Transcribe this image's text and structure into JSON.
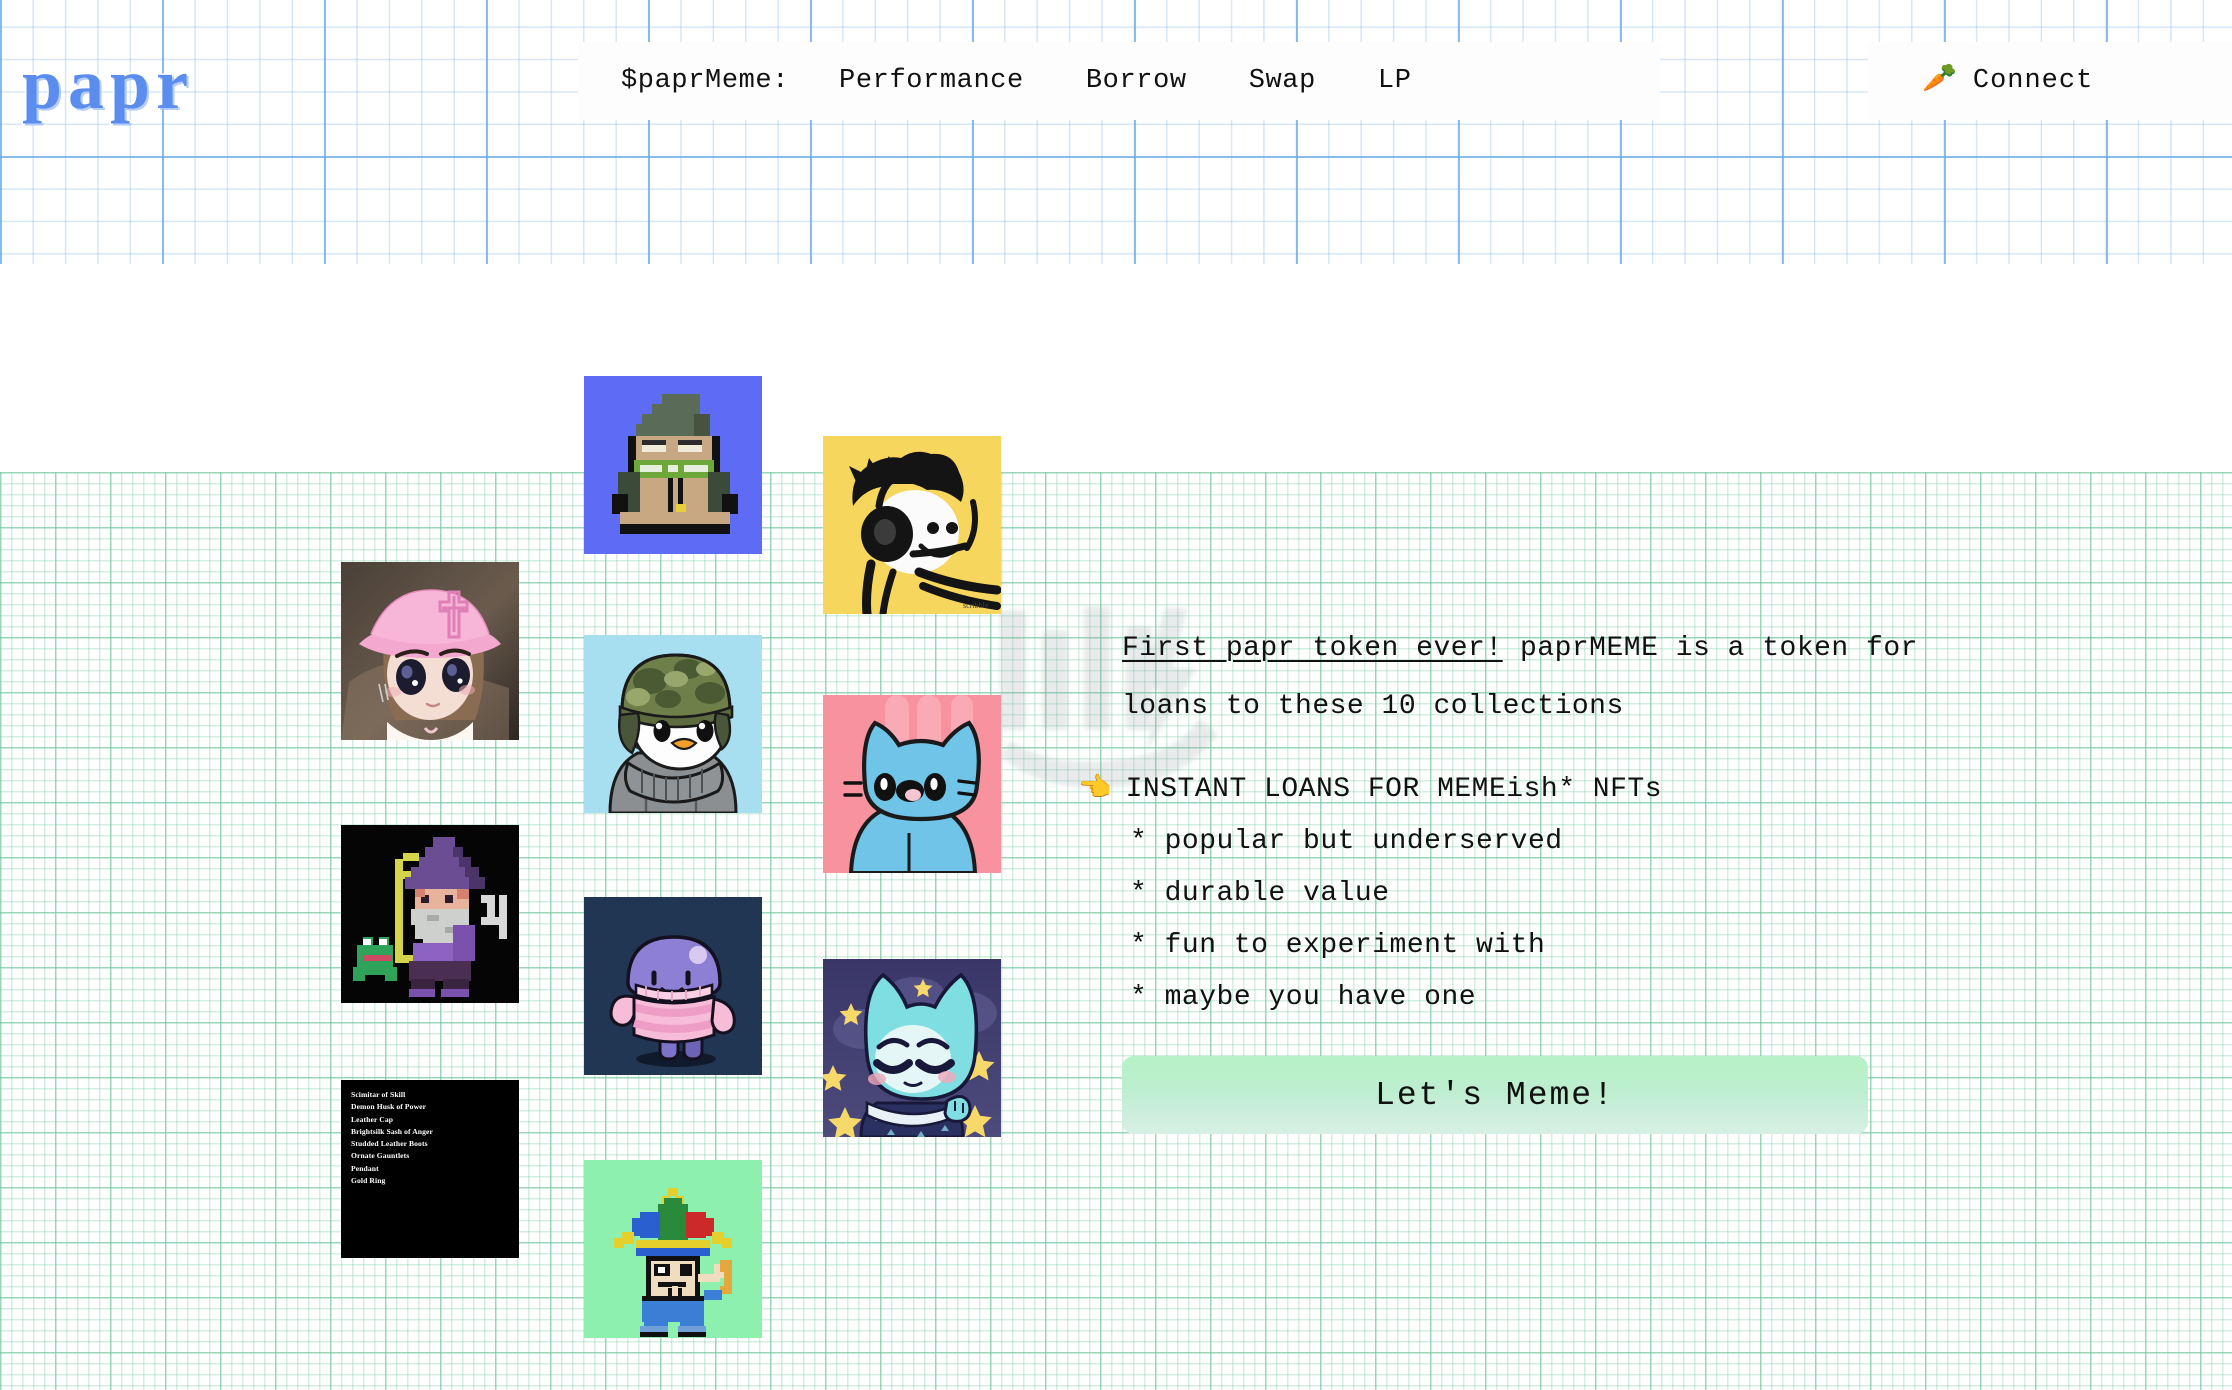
{
  "header": {
    "logo": "papr",
    "nav": [
      {
        "label": "$paprMeme:",
        "name": "nav-paprmeme"
      },
      {
        "label": "Performance",
        "name": "nav-performance"
      },
      {
        "label": "Borrow",
        "name": "nav-borrow"
      },
      {
        "label": "Swap",
        "name": "nav-swap"
      },
      {
        "label": "LP",
        "name": "nav-lp"
      }
    ],
    "connect": {
      "label": "Connect",
      "icon": "carrot-icon",
      "glyph": "🥕"
    }
  },
  "hero": {
    "lede_link": "First papr token ever!",
    "lede_rest": " paprMEME is a token for loans to these 10 collections",
    "point_emoji": "👈",
    "point_headline": "INSTANT LOANS FOR MEMEish* NFTs",
    "points": [
      "* popular but underserved",
      "* durable value",
      "* fun to experiment with",
      "* maybe you have one"
    ],
    "cta_label": "Let's Meme!"
  },
  "gallery": {
    "items": [
      {
        "name": "nft-milady-pink-cap",
        "alt": "anime girl with pink cross cap"
      },
      {
        "name": "nft-pixel-wizard",
        "alt": "pixel wizard with frog and staff"
      },
      {
        "name": "nft-loot-bag",
        "alt": "loot bag item list"
      },
      {
        "name": "nft-pixel-frog",
        "alt": "pixel frog on blue"
      },
      {
        "name": "nft-pudgy-penguin",
        "alt": "penguin with camo helmet"
      },
      {
        "name": "nft-purple-blob",
        "alt": "purple blob in pink striped sweater"
      },
      {
        "name": "nft-pixel-jester",
        "alt": "pixel jester on green"
      },
      {
        "name": "nft-doodle-headphones",
        "alt": "doodle face with headphones on yellow"
      },
      {
        "name": "nft-blue-cat",
        "alt": "blue cat on pink"
      },
      {
        "name": "nft-sleepy-cat",
        "alt": "sleepy blue cat with stars"
      }
    ],
    "loot_items": [
      "Scimitar of Skill",
      "Demon Husk of Power",
      "Leather Cap",
      "Brightsilk Sash of Anger",
      "Studded Leather Boots",
      "Ornate Gauntlets",
      "Pendant",
      "Gold Ring"
    ]
  },
  "colors": {
    "logo_blue": "#5b8def",
    "header_grid": "#6aaae6",
    "body_grid": "#76c8a0",
    "cta_green": "#b6f2c5",
    "text": "#111111"
  }
}
